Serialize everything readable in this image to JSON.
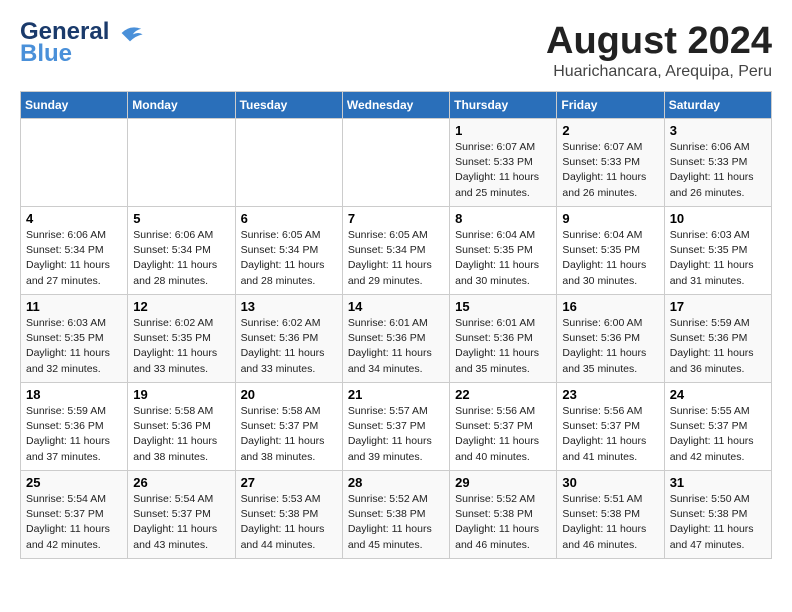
{
  "header": {
    "logo_general": "General",
    "logo_blue": "Blue",
    "main_title": "August 2024",
    "subtitle": "Huarichancara, Arequipa, Peru"
  },
  "weekdays": [
    "Sunday",
    "Monday",
    "Tuesday",
    "Wednesday",
    "Thursday",
    "Friday",
    "Saturday"
  ],
  "weeks": [
    [
      {
        "day": "",
        "info": ""
      },
      {
        "day": "",
        "info": ""
      },
      {
        "day": "",
        "info": ""
      },
      {
        "day": "",
        "info": ""
      },
      {
        "day": "1",
        "info": "Sunrise: 6:07 AM\nSunset: 5:33 PM\nDaylight: 11 hours\nand 25 minutes."
      },
      {
        "day": "2",
        "info": "Sunrise: 6:07 AM\nSunset: 5:33 PM\nDaylight: 11 hours\nand 26 minutes."
      },
      {
        "day": "3",
        "info": "Sunrise: 6:06 AM\nSunset: 5:33 PM\nDaylight: 11 hours\nand 26 minutes."
      }
    ],
    [
      {
        "day": "4",
        "info": "Sunrise: 6:06 AM\nSunset: 5:34 PM\nDaylight: 11 hours\nand 27 minutes."
      },
      {
        "day": "5",
        "info": "Sunrise: 6:06 AM\nSunset: 5:34 PM\nDaylight: 11 hours\nand 28 minutes."
      },
      {
        "day": "6",
        "info": "Sunrise: 6:05 AM\nSunset: 5:34 PM\nDaylight: 11 hours\nand 28 minutes."
      },
      {
        "day": "7",
        "info": "Sunrise: 6:05 AM\nSunset: 5:34 PM\nDaylight: 11 hours\nand 29 minutes."
      },
      {
        "day": "8",
        "info": "Sunrise: 6:04 AM\nSunset: 5:35 PM\nDaylight: 11 hours\nand 30 minutes."
      },
      {
        "day": "9",
        "info": "Sunrise: 6:04 AM\nSunset: 5:35 PM\nDaylight: 11 hours\nand 30 minutes."
      },
      {
        "day": "10",
        "info": "Sunrise: 6:03 AM\nSunset: 5:35 PM\nDaylight: 11 hours\nand 31 minutes."
      }
    ],
    [
      {
        "day": "11",
        "info": "Sunrise: 6:03 AM\nSunset: 5:35 PM\nDaylight: 11 hours\nand 32 minutes."
      },
      {
        "day": "12",
        "info": "Sunrise: 6:02 AM\nSunset: 5:35 PM\nDaylight: 11 hours\nand 33 minutes."
      },
      {
        "day": "13",
        "info": "Sunrise: 6:02 AM\nSunset: 5:36 PM\nDaylight: 11 hours\nand 33 minutes."
      },
      {
        "day": "14",
        "info": "Sunrise: 6:01 AM\nSunset: 5:36 PM\nDaylight: 11 hours\nand 34 minutes."
      },
      {
        "day": "15",
        "info": "Sunrise: 6:01 AM\nSunset: 5:36 PM\nDaylight: 11 hours\nand 35 minutes."
      },
      {
        "day": "16",
        "info": "Sunrise: 6:00 AM\nSunset: 5:36 PM\nDaylight: 11 hours\nand 35 minutes."
      },
      {
        "day": "17",
        "info": "Sunrise: 5:59 AM\nSunset: 5:36 PM\nDaylight: 11 hours\nand 36 minutes."
      }
    ],
    [
      {
        "day": "18",
        "info": "Sunrise: 5:59 AM\nSunset: 5:36 PM\nDaylight: 11 hours\nand 37 minutes."
      },
      {
        "day": "19",
        "info": "Sunrise: 5:58 AM\nSunset: 5:36 PM\nDaylight: 11 hours\nand 38 minutes."
      },
      {
        "day": "20",
        "info": "Sunrise: 5:58 AM\nSunset: 5:37 PM\nDaylight: 11 hours\nand 38 minutes."
      },
      {
        "day": "21",
        "info": "Sunrise: 5:57 AM\nSunset: 5:37 PM\nDaylight: 11 hours\nand 39 minutes."
      },
      {
        "day": "22",
        "info": "Sunrise: 5:56 AM\nSunset: 5:37 PM\nDaylight: 11 hours\nand 40 minutes."
      },
      {
        "day": "23",
        "info": "Sunrise: 5:56 AM\nSunset: 5:37 PM\nDaylight: 11 hours\nand 41 minutes."
      },
      {
        "day": "24",
        "info": "Sunrise: 5:55 AM\nSunset: 5:37 PM\nDaylight: 11 hours\nand 42 minutes."
      }
    ],
    [
      {
        "day": "25",
        "info": "Sunrise: 5:54 AM\nSunset: 5:37 PM\nDaylight: 11 hours\nand 42 minutes."
      },
      {
        "day": "26",
        "info": "Sunrise: 5:54 AM\nSunset: 5:37 PM\nDaylight: 11 hours\nand 43 minutes."
      },
      {
        "day": "27",
        "info": "Sunrise: 5:53 AM\nSunset: 5:38 PM\nDaylight: 11 hours\nand 44 minutes."
      },
      {
        "day": "28",
        "info": "Sunrise: 5:52 AM\nSunset: 5:38 PM\nDaylight: 11 hours\nand 45 minutes."
      },
      {
        "day": "29",
        "info": "Sunrise: 5:52 AM\nSunset: 5:38 PM\nDaylight: 11 hours\nand 46 minutes."
      },
      {
        "day": "30",
        "info": "Sunrise: 5:51 AM\nSunset: 5:38 PM\nDaylight: 11 hours\nand 46 minutes."
      },
      {
        "day": "31",
        "info": "Sunrise: 5:50 AM\nSunset: 5:38 PM\nDaylight: 11 hours\nand 47 minutes."
      }
    ]
  ]
}
